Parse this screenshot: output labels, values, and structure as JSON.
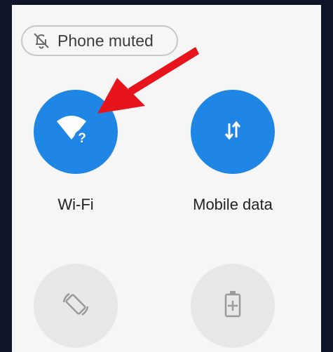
{
  "status_chip": {
    "label": "Phone muted",
    "icon": "bell-off-icon"
  },
  "tiles": [
    {
      "label": "Wi-Fi",
      "icon": "wifi-question-icon",
      "state": "on",
      "color": "#1f86e6"
    },
    {
      "label": "Mobile data",
      "icon": "mobile-data-arrows-icon",
      "state": "on",
      "color": "#1f86e6"
    },
    {
      "label": "",
      "icon": "auto-rotate-icon",
      "state": "off",
      "color": "#e8e8e8"
    },
    {
      "label": "",
      "icon": "battery-saver-icon",
      "state": "off",
      "color": "#e8e8e8"
    }
  ],
  "annotation": {
    "arrow_color": "#e8141b"
  }
}
